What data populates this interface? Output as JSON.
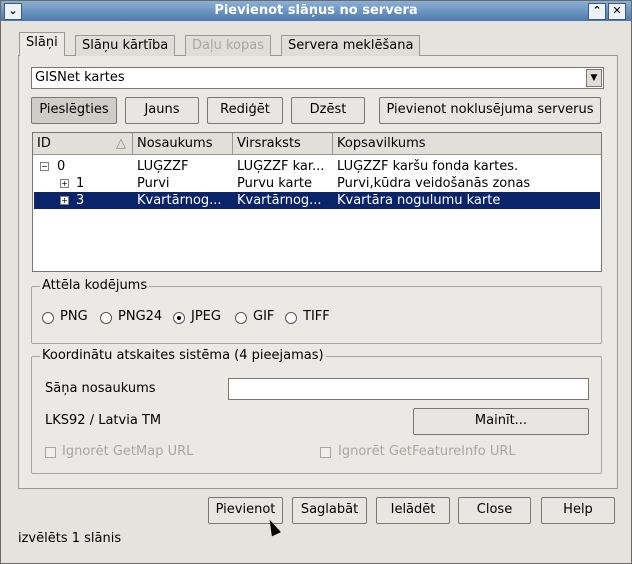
{
  "window": {
    "title": "Pievienot slāņus no servera"
  },
  "tabs": [
    {
      "label": "Slāņi",
      "state": "active"
    },
    {
      "label": "Slāņu kārtība",
      "state": "normal"
    },
    {
      "label": "Daļu kopas",
      "state": "disabled"
    },
    {
      "label": "Servera meklēšana",
      "state": "normal"
    }
  ],
  "connection": {
    "selected": "GISNet kartes"
  },
  "conn_buttons": {
    "connect": "Pieslēgties",
    "new": "Jauns",
    "edit": "Rediģēt",
    "delete": "Dzēst",
    "add_default": "Pievienot noklusējuma serverus"
  },
  "layer_tree": {
    "columns": [
      "ID",
      "Nosaukums",
      "Virsraksts",
      "Kopsavilkums"
    ],
    "rows": [
      {
        "expander": "−",
        "id": "0",
        "name": "LUĢZZF",
        "title": "LUĢZZF kar...",
        "summary": "LUĢZZF karšu fonda kartes.",
        "selected": false
      },
      {
        "expander": "+",
        "id": "1",
        "name": "Purvi",
        "title": "Purvu karte",
        "summary": "Purvi,kūdra veidošanās zonas",
        "selected": false
      },
      {
        "expander": "+",
        "id": "3",
        "name": "Kvartārnog...",
        "title": "Kvartārnog...",
        "summary": "Kvartāra nogulumu karte",
        "selected": true
      }
    ]
  },
  "encoding": {
    "title": "Attēla kodējums",
    "options": [
      "PNG",
      "PNG24",
      "JPEG",
      "GIF",
      "TIFF"
    ],
    "selected": "JPEG"
  },
  "crs": {
    "title": "Koordinātu atskaites sistēma (4 pieejamas)",
    "layer_name_label": "Sāņa nosaukums",
    "layer_name_value": "",
    "current": "LKS92 / Latvia TM",
    "change_button": "Mainīt...",
    "ignore_getmap": "Ignorēt GetMap URL",
    "ignore_getfeatureinfo": "Ignorēt GetFeatureInfo URL"
  },
  "bottom_buttons": {
    "add": "Pievienot",
    "save": "Saglabāt",
    "load": "Ielādēt",
    "close": "Close",
    "help": "Help"
  },
  "status": "izvēlēts 1 slānis",
  "icons": {
    "menu": "chevron-down-icon",
    "collapse": "chevron-up-icon",
    "close": "close-icon",
    "sort": "sort-triangle-icon"
  },
  "colors": {
    "titlebar": "#4d79ab",
    "selection": "#0a246a"
  }
}
